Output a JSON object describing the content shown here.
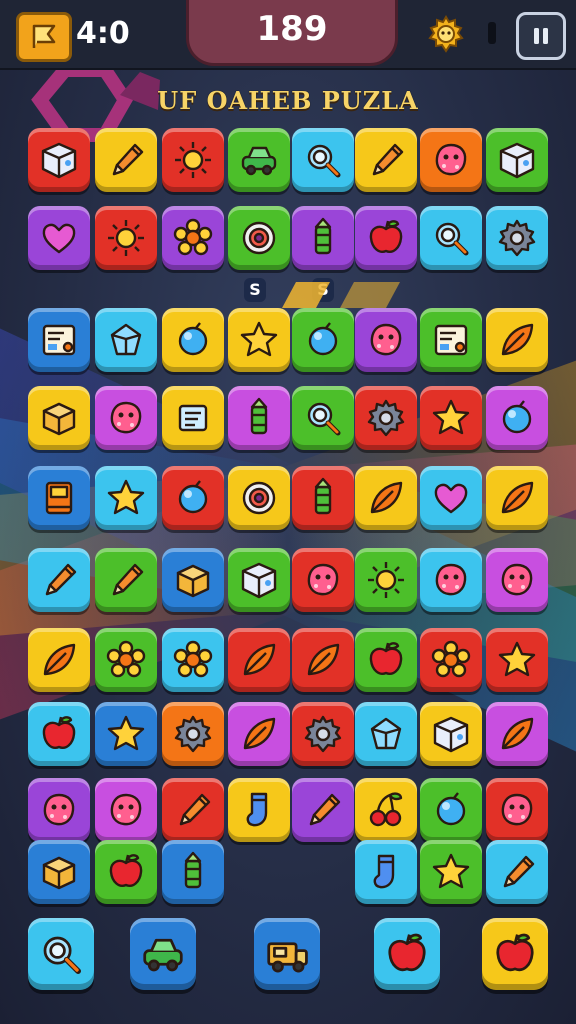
{
  "hud": {
    "moves": "4:0",
    "score": "189",
    "moves_icon": "flag-icon",
    "hint_icon": "gear-icon",
    "pause_icon": "pause-icon"
  },
  "title": "UF OAHEB PUZLA",
  "markers": [
    "S",
    "S"
  ],
  "colors": {
    "red": "#e23127",
    "orange": "#f47516",
    "yellow": "#f6c81a",
    "green": "#4cbf2a",
    "cyan": "#3cc4ee",
    "blue": "#2a7fd6",
    "purple": "#9a45d8",
    "magenta": "#c84fe0"
  },
  "board": [
    [
      {
        "c": "red",
        "i": "cube-icon"
      },
      {
        "c": "yellow",
        "i": "pencil-icon"
      },
      {
        "c": "red",
        "i": "sun-icon"
      },
      {
        "c": "green",
        "i": "car-icon"
      },
      {
        "c": "cyan",
        "i": "magnifier-icon"
      },
      {
        "c": "yellow",
        "i": "pencil-icon"
      },
      {
        "c": "orange",
        "i": "blob-icon"
      },
      {
        "c": "green",
        "i": "cube-icon"
      }
    ],
    [
      {
        "c": "purple",
        "i": "heart-icon"
      },
      {
        "c": "red",
        "i": "sun-icon"
      },
      {
        "c": "purple",
        "i": "flower-icon"
      },
      {
        "c": "green",
        "i": "donut-icon"
      },
      {
        "c": "purple",
        "i": "crayon-icon"
      },
      {
        "c": "purple",
        "i": "apple-icon"
      },
      {
        "c": "cyan",
        "i": "magnifier-icon"
      },
      {
        "c": "cyan",
        "i": "gear-icon"
      }
    ],
    [
      {
        "c": "blue",
        "i": "card-icon"
      },
      {
        "c": "cyan",
        "i": "gem-icon"
      },
      {
        "c": "yellow",
        "i": "ball-icon"
      },
      {
        "c": "yellow",
        "i": "star-icon"
      },
      {
        "c": "green",
        "i": "ball-icon"
      },
      {
        "c": "purple",
        "i": "blob-icon"
      },
      {
        "c": "green",
        "i": "card-icon"
      },
      {
        "c": "yellow",
        "i": "leaf-icon"
      }
    ],
    [
      {
        "c": "yellow",
        "i": "box-icon"
      },
      {
        "c": "magenta",
        "i": "blob-icon"
      },
      {
        "c": "yellow",
        "i": "scroll-icon"
      },
      {
        "c": "magenta",
        "i": "crayon-icon"
      },
      {
        "c": "green",
        "i": "magnifier-icon"
      },
      {
        "c": "red",
        "i": "gear-icon"
      },
      {
        "c": "red",
        "i": "star-icon"
      },
      {
        "c": "magenta",
        "i": "ball-icon"
      }
    ],
    [
      {
        "c": "blue",
        "i": "book-icon"
      },
      {
        "c": "cyan",
        "i": "star-icon"
      },
      {
        "c": "red",
        "i": "ball-icon"
      },
      {
        "c": "yellow",
        "i": "donut-icon"
      },
      {
        "c": "red",
        "i": "crayon-icon"
      },
      {
        "c": "yellow",
        "i": "leaf-icon"
      },
      {
        "c": "cyan",
        "i": "heart-icon"
      },
      {
        "c": "yellow",
        "i": "leaf-icon"
      }
    ],
    [
      {
        "c": "cyan",
        "i": "pencil-icon"
      },
      {
        "c": "green",
        "i": "pencil-icon"
      },
      {
        "c": "blue",
        "i": "box-icon"
      },
      {
        "c": "green",
        "i": "cube-icon"
      },
      {
        "c": "red",
        "i": "blob-icon"
      },
      {
        "c": "green",
        "i": "sun-icon"
      },
      {
        "c": "cyan",
        "i": "blob-icon"
      },
      {
        "c": "magenta",
        "i": "blob-icon"
      }
    ],
    [
      {
        "c": "yellow",
        "i": "leaf-icon"
      },
      {
        "c": "green",
        "i": "flower-icon"
      },
      {
        "c": "cyan",
        "i": "flower-icon"
      },
      {
        "c": "red",
        "i": "leaf-icon"
      },
      {
        "c": "red",
        "i": "leaf-icon"
      },
      {
        "c": "green",
        "i": "apple-icon"
      },
      {
        "c": "red",
        "i": "flower-icon"
      },
      {
        "c": "red",
        "i": "star-icon"
      }
    ],
    [
      {
        "c": "cyan",
        "i": "apple-icon"
      },
      {
        "c": "blue",
        "i": "star-icon"
      },
      {
        "c": "orange",
        "i": "gear-icon"
      },
      {
        "c": "magenta",
        "i": "leaf-icon"
      },
      {
        "c": "red",
        "i": "gear-icon"
      },
      {
        "c": "cyan",
        "i": "gem-icon"
      },
      {
        "c": "yellow",
        "i": "cube-icon"
      },
      {
        "c": "magenta",
        "i": "leaf-icon"
      }
    ],
    [
      {
        "c": "purple",
        "i": "blob-icon"
      },
      {
        "c": "magenta",
        "i": "blob-icon"
      },
      {
        "c": "red",
        "i": "pencil-icon"
      },
      {
        "c": "yellow",
        "i": "sock-icon"
      },
      {
        "c": "purple",
        "i": "pencil-icon"
      },
      {
        "c": "yellow",
        "i": "cherry-icon"
      },
      {
        "c": "green",
        "i": "ball-icon"
      },
      {
        "c": "red",
        "i": "blob-icon"
      }
    ],
    [
      {
        "c": "blue",
        "i": "box-icon"
      },
      {
        "c": "green",
        "i": "apple-icon"
      },
      {
        "c": "blue",
        "i": "crayon-icon"
      },
      null,
      null,
      {
        "c": "cyan",
        "i": "sock-icon"
      },
      {
        "c": "green",
        "i": "star-icon"
      },
      {
        "c": "cyan",
        "i": "pencil-icon"
      }
    ]
  ],
  "tray": [
    {
      "c": "cyan",
      "i": "magnifier-icon"
    },
    {
      "c": "blue",
      "i": "car-icon"
    },
    {
      "c": "blue",
      "i": "truck-icon"
    },
    {
      "c": "cyan",
      "i": "apple-icon"
    },
    {
      "c": "yellow",
      "i": "apple-icon"
    }
  ]
}
